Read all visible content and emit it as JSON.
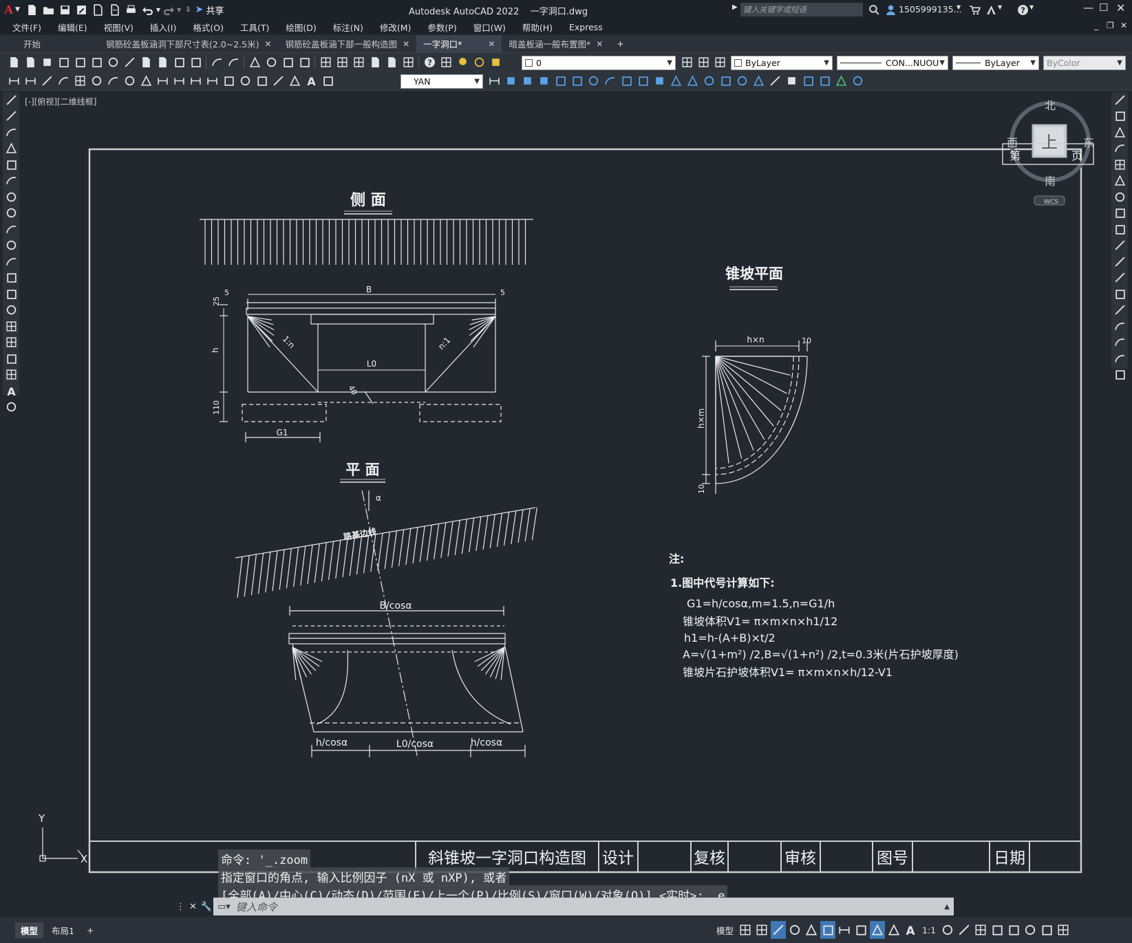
{
  "app": {
    "title": "Autodesk AutoCAD 2022",
    "filename": "一字洞口.dwg",
    "share": "共享",
    "search_placeholder": "键入关键字或短语",
    "user": "1505999135..."
  },
  "menu": [
    "文件(F)",
    "编辑(E)",
    "视图(V)",
    "插入(I)",
    "格式(O)",
    "工具(T)",
    "绘图(D)",
    "标注(N)",
    "修改(M)",
    "参数(P)",
    "窗口(W)",
    "帮助(H)",
    "Express"
  ],
  "tabs": [
    {
      "label": "开始",
      "active": false
    },
    {
      "label": "钢筋砼盖板涵洞下部尺寸表(2.0~2.5米)",
      "active": false
    },
    {
      "label": "钢筋砼盖板涵下部一般构造图",
      "active": false
    },
    {
      "label": "一字洞口*",
      "active": true
    },
    {
      "label": "暗盖板涵一般布置图*",
      "active": false
    }
  ],
  "toolbar": {
    "layer": "0",
    "color": "ByLayer",
    "linetype": "CON...NUOU",
    "lineweight": "ByLayer",
    "plotstyle": "ByColor",
    "dimstyle": "YAN"
  },
  "viewport_label": "[-][俯视][二维线框]",
  "viewcube": {
    "north": "北",
    "south": "南",
    "east": "东",
    "west": "西",
    "top": "上",
    "wcs": "WCS"
  },
  "drawing": {
    "side_title": "侧 面",
    "plan_title": "平 面",
    "cone_title": "锥坡平面",
    "side_dims": {
      "left5": "5",
      "right5": "5",
      "B": "B",
      "d25": "25",
      "h": "h",
      "d110": "110",
      "L0": "L0",
      "d40": "40",
      "G1": "G1",
      "n1": "1:n",
      "n2": "n:1"
    },
    "cone_dims": {
      "hxn": "h×n",
      "d10a": "10",
      "hxm": "h×m",
      "d10b": "10"
    },
    "plan_dims": {
      "alpha": "α",
      "road": "路基边线",
      "Bcos": "B/cosα",
      "h1": "h/cosα",
      "L0cos": "L0/cosα",
      "h2": "h/cosα"
    },
    "notes": {
      "head": "注:",
      "l1": "1.图中代号计算如下:",
      "l2": "G1=h/cosα,m=1.5,n=G1/h",
      "l3": "锥坡体积V1= π×m×n×h1/12",
      "l4": "h1=h-(A+B)×t/2",
      "l5": "A=√(1+m²) /2,B=√(1+n²) /2,t=0.3米(片石护坡厚度)",
      "l6": "锥坡片石护坡体积V1= π×m×n×h/12-V1"
    },
    "titleblock": {
      "title": "斜锥坡一字洞口构造图",
      "design": "设计",
      "check": "复核",
      "review": "审核",
      "drawno": "图号",
      "date": "日期",
      "sheet_a": "第",
      "sheet_b": "页"
    }
  },
  "command": {
    "line1": "命令: '_.zoom",
    "line2": "指定窗口的角点, 输入比例因子 (nX 或 nXP), 或者",
    "line3": "[全部(A)/中心(C)/动态(D)/范围(E)/上一个(P)/比例(S)/窗口(W)/对象(O)] <实时>: _e",
    "placeholder": "键入命令"
  },
  "ucs": {
    "x": "X",
    "y": "Y"
  },
  "status": {
    "model_tab": "模型",
    "layout_tab": "布局1",
    "add": "+",
    "model_btn": "模型",
    "scale": "1:1"
  }
}
